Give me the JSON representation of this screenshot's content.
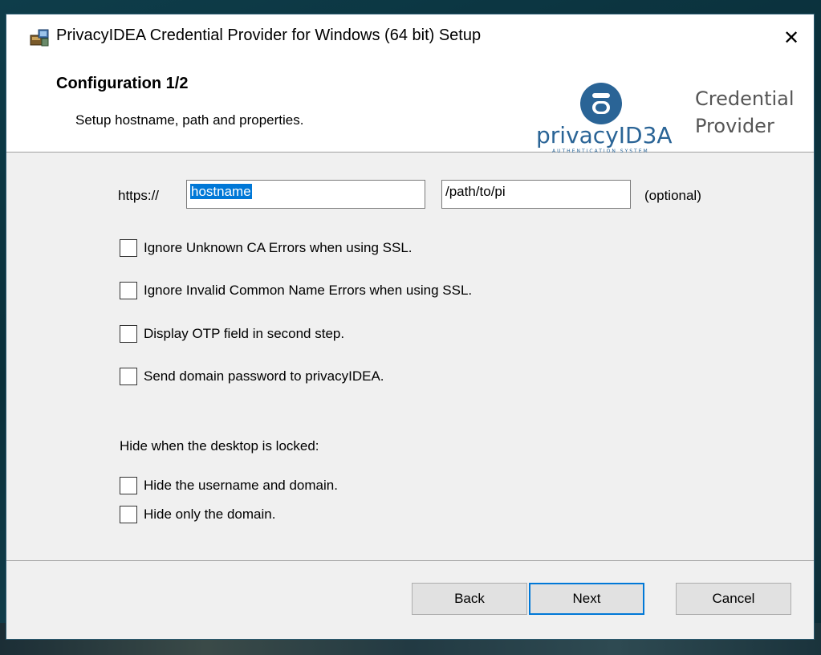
{
  "window": {
    "title": "PrivacyIDEA Credential Provider for Windows (64 bit) Setup",
    "close_glyph": "✕"
  },
  "banner": {
    "title": "Configuration 1/2",
    "subtitle": "Setup hostname, path and properties.",
    "logo_text_main": "privacyID3A",
    "logo_text_sub": "AUTHENTICATION SYSTEM",
    "product_line1": "Credential",
    "product_line2": "Provider"
  },
  "form": {
    "scheme_label": "https://",
    "hostname_value": "hostname",
    "path_value": "/path/to/pi",
    "optional_label": "(optional)",
    "options": [
      {
        "label": "Ignore Unknown CA Errors when using SSL.",
        "checked": false
      },
      {
        "label": "Ignore Invalid Common Name Errors when using SSL.",
        "checked": false
      },
      {
        "label": "Display OTP field in second step.",
        "checked": false
      },
      {
        "label": "Send domain password to privacyIDEA.",
        "checked": false
      }
    ],
    "hide_section_label": "Hide when the desktop is locked:",
    "hide_options": [
      {
        "label": "Hide the username and domain.",
        "checked": false
      },
      {
        "label": "Hide only the domain.",
        "checked": false
      }
    ]
  },
  "buttons": {
    "back": "Back",
    "next": "Next",
    "cancel": "Cancel"
  },
  "colors": {
    "accent": "#0078d7",
    "logo_blue": "#2a6496"
  },
  "icons": [
    "installer-icon",
    "close-icon",
    "privacyidea-logo"
  ]
}
